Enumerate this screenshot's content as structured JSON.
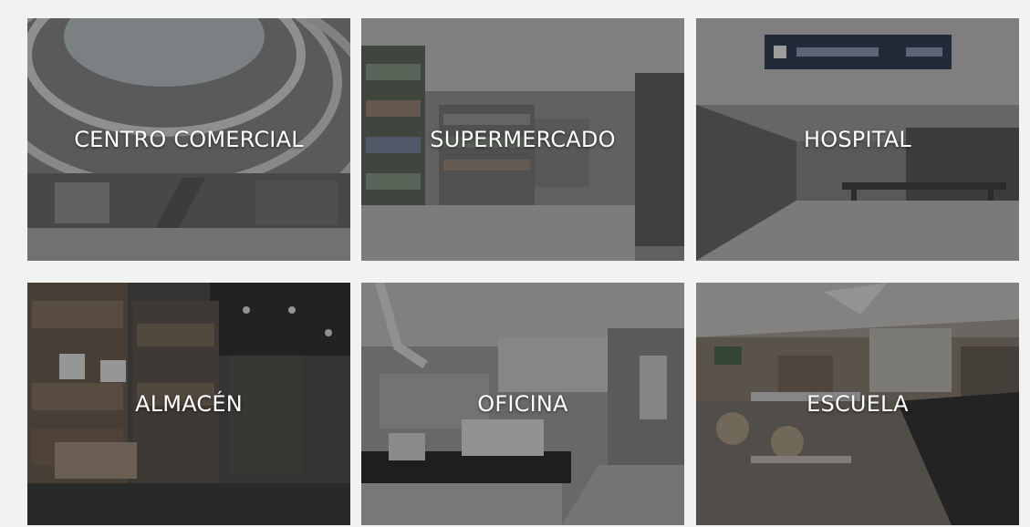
{
  "tiles": [
    {
      "label": "CENTRO COMERCIAL",
      "scene": "mall"
    },
    {
      "label": "SUPERMERCADO",
      "scene": "supermarket"
    },
    {
      "label": "HOSPITAL",
      "scene": "hospital"
    },
    {
      "label": "ALMACÉN",
      "scene": "warehouse"
    },
    {
      "label": "OFICINA",
      "scene": "office"
    },
    {
      "label": "ESCUELA",
      "scene": "school"
    }
  ]
}
